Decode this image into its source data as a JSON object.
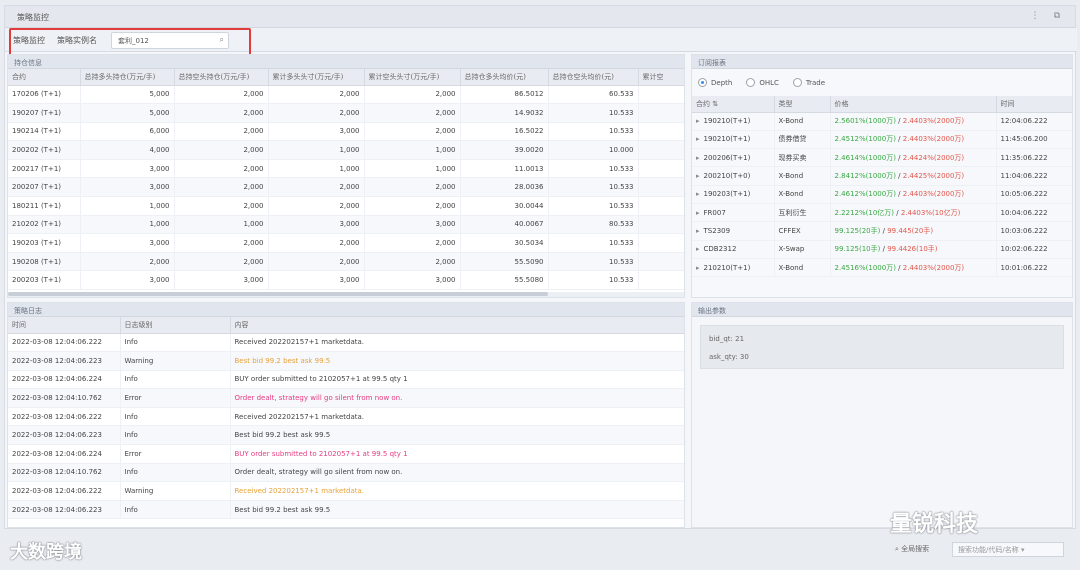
{
  "window": {
    "title": "策略监控"
  },
  "toolbar": {
    "tab1": "策略监控",
    "tab2": "策略实例名",
    "search_value": "套利_012"
  },
  "positions": {
    "title": "持仓信息",
    "columns": [
      "合约",
      "总持多头持仓(万元/手)",
      "总持空头持仓(万元/手)",
      "累计多头头寸(万元/手)",
      "累计空头头寸(万元/手)",
      "总持仓多头均价(元)",
      "总持仓空头均价(元)",
      "累计空"
    ],
    "rows": [
      [
        "170206 (T+1)",
        "5,000",
        "2,000",
        "2,000",
        "2,000",
        "86.5012",
        "60.533"
      ],
      [
        "190207 (T+1)",
        "5,000",
        "2,000",
        "2,000",
        "2,000",
        "14.9032",
        "10.533"
      ],
      [
        "190214 (T+1)",
        "6,000",
        "2,000",
        "3,000",
        "2,000",
        "16.5022",
        "10.533"
      ],
      [
        "200202 (T+1)",
        "4,000",
        "2,000",
        "1,000",
        "1,000",
        "39.0020",
        "10.000"
      ],
      [
        "200217 (T+1)",
        "3,000",
        "2,000",
        "1,000",
        "1,000",
        "11.0013",
        "10.533"
      ],
      [
        "200207 (T+1)",
        "3,000",
        "2,000",
        "2,000",
        "2,000",
        "28.0036",
        "10.533"
      ],
      [
        "180211 (T+1)",
        "1,000",
        "2,000",
        "2,000",
        "2,000",
        "30.0044",
        "10.533"
      ],
      [
        "210202 (T+1)",
        "1,000",
        "1,000",
        "3,000",
        "3,000",
        "40.0067",
        "80.533"
      ],
      [
        "190203 (T+1)",
        "3,000",
        "2,000",
        "2,000",
        "2,000",
        "30.5034",
        "10.533"
      ],
      [
        "190208 (T+1)",
        "2,000",
        "2,000",
        "2,000",
        "2,000",
        "55.5090",
        "10.533"
      ],
      [
        "200203 (T+1)",
        "3,000",
        "3,000",
        "3,000",
        "3,000",
        "55.5080",
        "10.533"
      ]
    ]
  },
  "book": {
    "title": "订阅报表",
    "radios": [
      "Depth",
      "OHLC",
      "Trade"
    ],
    "columns": [
      "合约 ⇅",
      "类型",
      "价格",
      "时间"
    ],
    "rows": [
      {
        "code": "190210(T+1)",
        "type": "X-Bond",
        "bid": "2.5601%(1000万)",
        "ask": "2.4403%(2000万)",
        "time": "12:04:06.222"
      },
      {
        "code": "190210(T+1)",
        "type": "债券借贷",
        "bid": "2.4512%(1000万)",
        "ask": "2.4403%(2000万)",
        "time": "11:45:06.200"
      },
      {
        "code": "200206(T+1)",
        "type": "现券买卖",
        "bid": "2.4614%(1000万)",
        "ask": "2.4424%(2000万)",
        "time": "11:35:06.222"
      },
      {
        "code": "200210(T+0)",
        "type": "X-Bond",
        "bid": "2.8412%(1000万)",
        "ask": "2.4425%(2000万)",
        "time": "11:04:06.222"
      },
      {
        "code": "190203(T+1)",
        "type": "X-Bond",
        "bid": "2.4612%(1000万)",
        "ask": "2.4403%(2000万)",
        "time": "10:05:06.222"
      },
      {
        "code": "FR007",
        "type": "互利衍生",
        "bid": "2.2212%(10亿万)",
        "ask": "2.4403%(10亿万)",
        "time": "10:04:06.222"
      },
      {
        "code": "TS2309",
        "type": "CFFEX",
        "bid": "99.125(20手)",
        "ask": "99.445(20手)",
        "time": "10:03:06.222"
      },
      {
        "code": "CDB2312",
        "type": "X-Swap",
        "bid": "99.125(10手)",
        "ask": "99.4426(10手)",
        "time": "10:02:06.222"
      },
      {
        "code": "210210(T+1)",
        "type": "X-Bond",
        "bid": "2.4516%(1000万)",
        "ask": "2.4403%(2000万)",
        "time": "10:01:06.222"
      }
    ],
    "separator": " / "
  },
  "logs": {
    "title": "策略日志",
    "columns": [
      "时间",
      "日志级别",
      "内容"
    ],
    "rows": [
      {
        "time": "2022-03-08 12:04:06.222",
        "level": "Info",
        "msg": "Received 202202157+1 marketdata.",
        "kind": "info"
      },
      {
        "time": "2022-03-08 12:04:06.223",
        "level": "Warning",
        "msg": "Best bid 99.2 best ask 99.5",
        "kind": "warn"
      },
      {
        "time": "2022-03-08 12:04:06.224",
        "level": "Info",
        "msg": "BUY order submitted to 2102057+1 at 99.5 qty 1",
        "kind": "info"
      },
      {
        "time": "2022-03-08 12:04:10.762",
        "level": "Error",
        "msg": "Order dealt, strategy will go silent from now on.",
        "kind": "err"
      },
      {
        "time": "2022-03-08 12:04:06.222",
        "level": "Info",
        "msg": "Received 202202157+1 marketdata.",
        "kind": "info"
      },
      {
        "time": "2022-03-08 12:04:06.223",
        "level": "Info",
        "msg": "Best bid 99.2 best ask 99.5",
        "kind": "info"
      },
      {
        "time": "2022-03-08 12:04:06.224",
        "level": "Error",
        "msg": "BUY order submitted to 2102057+1 at 99.5 qty 1",
        "kind": "err"
      },
      {
        "time": "2022-03-08 12:04:10.762",
        "level": "Info",
        "msg": "Order dealt, strategy will go silent from now on.",
        "kind": "info"
      },
      {
        "time": "2022-03-08 12:04:06.222",
        "level": "Warning",
        "msg": "Received 202202157+1 marketdata.",
        "kind": "warn"
      },
      {
        "time": "2022-03-08 12:04:06.223",
        "level": "Info",
        "msg": "Best bid 99.2 best ask 99.5",
        "kind": "info"
      }
    ]
  },
  "params": {
    "title": "输出参数",
    "items": [
      {
        "label": "bid_qt:",
        "value": "21"
      },
      {
        "label": "ask_qty:",
        "value": "30"
      }
    ]
  },
  "status": {
    "search_label": "全局搜索",
    "select_placeholder": "搜索功能/代码/名称"
  },
  "watermarks": {
    "right": "量锐科技",
    "left": "大数跨境"
  },
  "colors": {
    "highlight": "#e23b3b",
    "bid": "#3aa845",
    "ask": "#e2574c",
    "warning": "#e7a23a",
    "error": "#e63c82"
  }
}
